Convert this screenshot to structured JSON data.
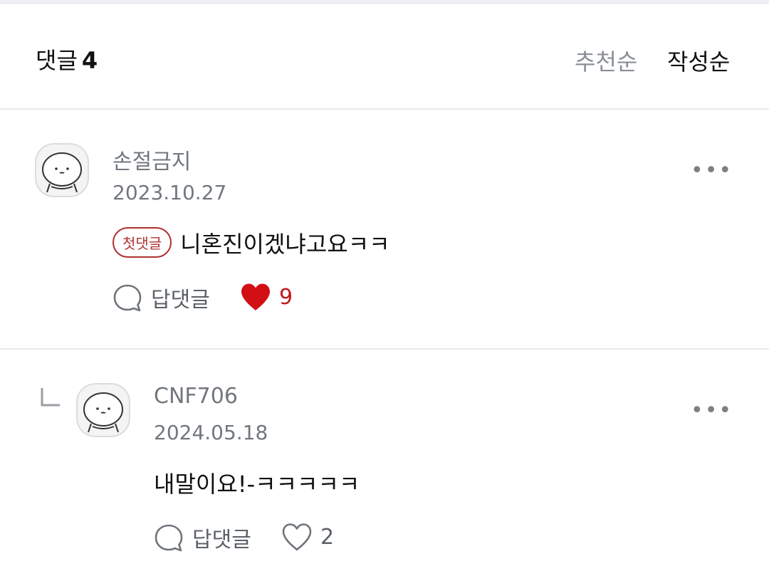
{
  "header": {
    "title": "댓글",
    "count": "4",
    "sort_recommended": "추천순",
    "sort_newest": "작성순"
  },
  "comments": [
    {
      "author": "손절금지",
      "date": "2023.10.27",
      "badge": "첫댓글",
      "text": "니혼진이겠냐고요ㅋㅋ",
      "reply_label": "답댓글",
      "likes": "9",
      "liked": true,
      "more": "•••"
    },
    {
      "author": "CNF706",
      "date": "2024.05.18",
      "text": "내말이요!-ㅋㅋㅋㅋㅋ",
      "reply_label": "답댓글",
      "likes": "2",
      "liked": false,
      "more": "•••"
    }
  ],
  "colors": {
    "like_active": "#c4171b",
    "badge": "#b03030",
    "meta_gray": "#72777e"
  },
  "icons": [
    "avatar-icon",
    "speech-bubble-icon",
    "heart-filled-icon",
    "heart-outline-icon",
    "more-icon",
    "reply-arrow-icon"
  ]
}
